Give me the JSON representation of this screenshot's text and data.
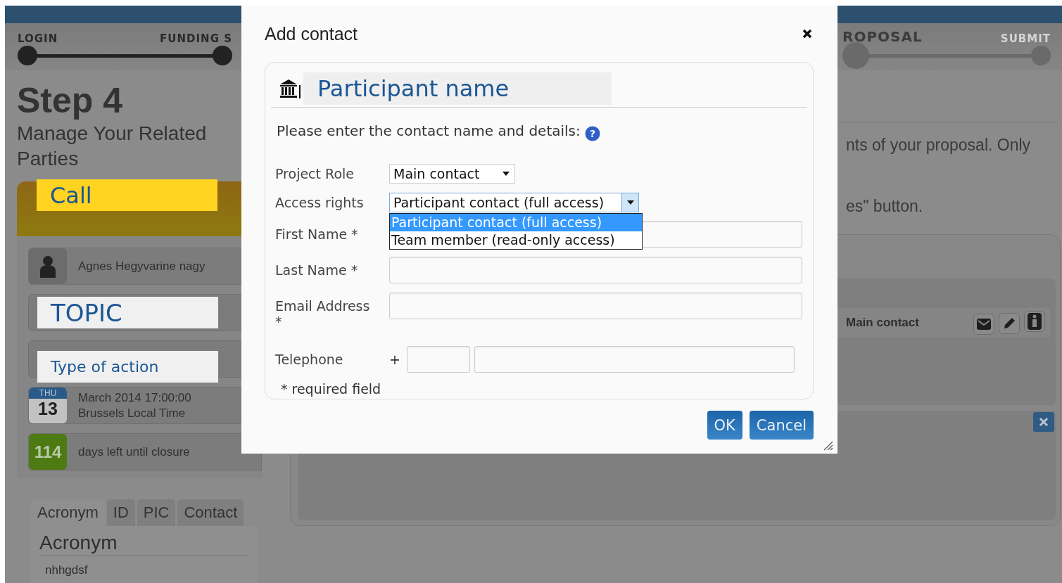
{
  "stepper": {
    "left": [
      {
        "label": "LOGIN",
        "reached": true,
        "current": false
      },
      {
        "label": "FUNDING S",
        "reached": true,
        "current": false
      }
    ],
    "right": [
      {
        "label": "ROPOSAL",
        "reached": false,
        "current": true
      },
      {
        "label": "SUBMIT",
        "reached": false,
        "current": false
      }
    ]
  },
  "sidebar": {
    "heading": "Step 4",
    "subheading": "Manage Your Related Parties",
    "call_label": "Call",
    "contact_name": "Agnes Hegyvarine nagy",
    "topic_label": "TOPIC",
    "type_label": "Type of action",
    "deadline": {
      "weekday": "THU",
      "day": "13",
      "line1": "March 2014 17:00:00",
      "line2": "Brussels Local Time"
    },
    "days_left": {
      "count": "114",
      "text": "days left until closure"
    },
    "tabs": [
      {
        "label": "Acronym",
        "selected": true
      },
      {
        "label": "ID",
        "selected": false
      },
      {
        "label": "PIC",
        "selected": false
      },
      {
        "label": "Contact",
        "selected": false
      }
    ],
    "panel": {
      "title": "Acronym",
      "value": "nhhgdsf"
    }
  },
  "main": {
    "intro_lines": [
      "nts of your proposal. Only",
      "es\" button."
    ],
    "contact_row": {
      "role": "Main contact"
    }
  },
  "dialog": {
    "title": "Add contact",
    "participant_name": "Participant name",
    "instruction": "Please enter the contact name and details:",
    "help_mark": "?",
    "project_role": {
      "label": "Project Role",
      "value": "Main contact"
    },
    "access_rights": {
      "label": "Access rights",
      "value": "Participant contact (full access)",
      "expanded": true,
      "options": [
        {
          "label": "Participant contact (full access)",
          "selected": true
        },
        {
          "label": "Team member (read-only access)",
          "selected": false
        }
      ]
    },
    "fields": [
      {
        "label": "First Name *"
      },
      {
        "label": "Last Name *"
      },
      {
        "label": "Email Address *"
      }
    ],
    "telephone": {
      "label": "Telephone",
      "prefix": "+"
    },
    "note": "* required field",
    "buttons": [
      "OK",
      "Cancel"
    ]
  }
}
